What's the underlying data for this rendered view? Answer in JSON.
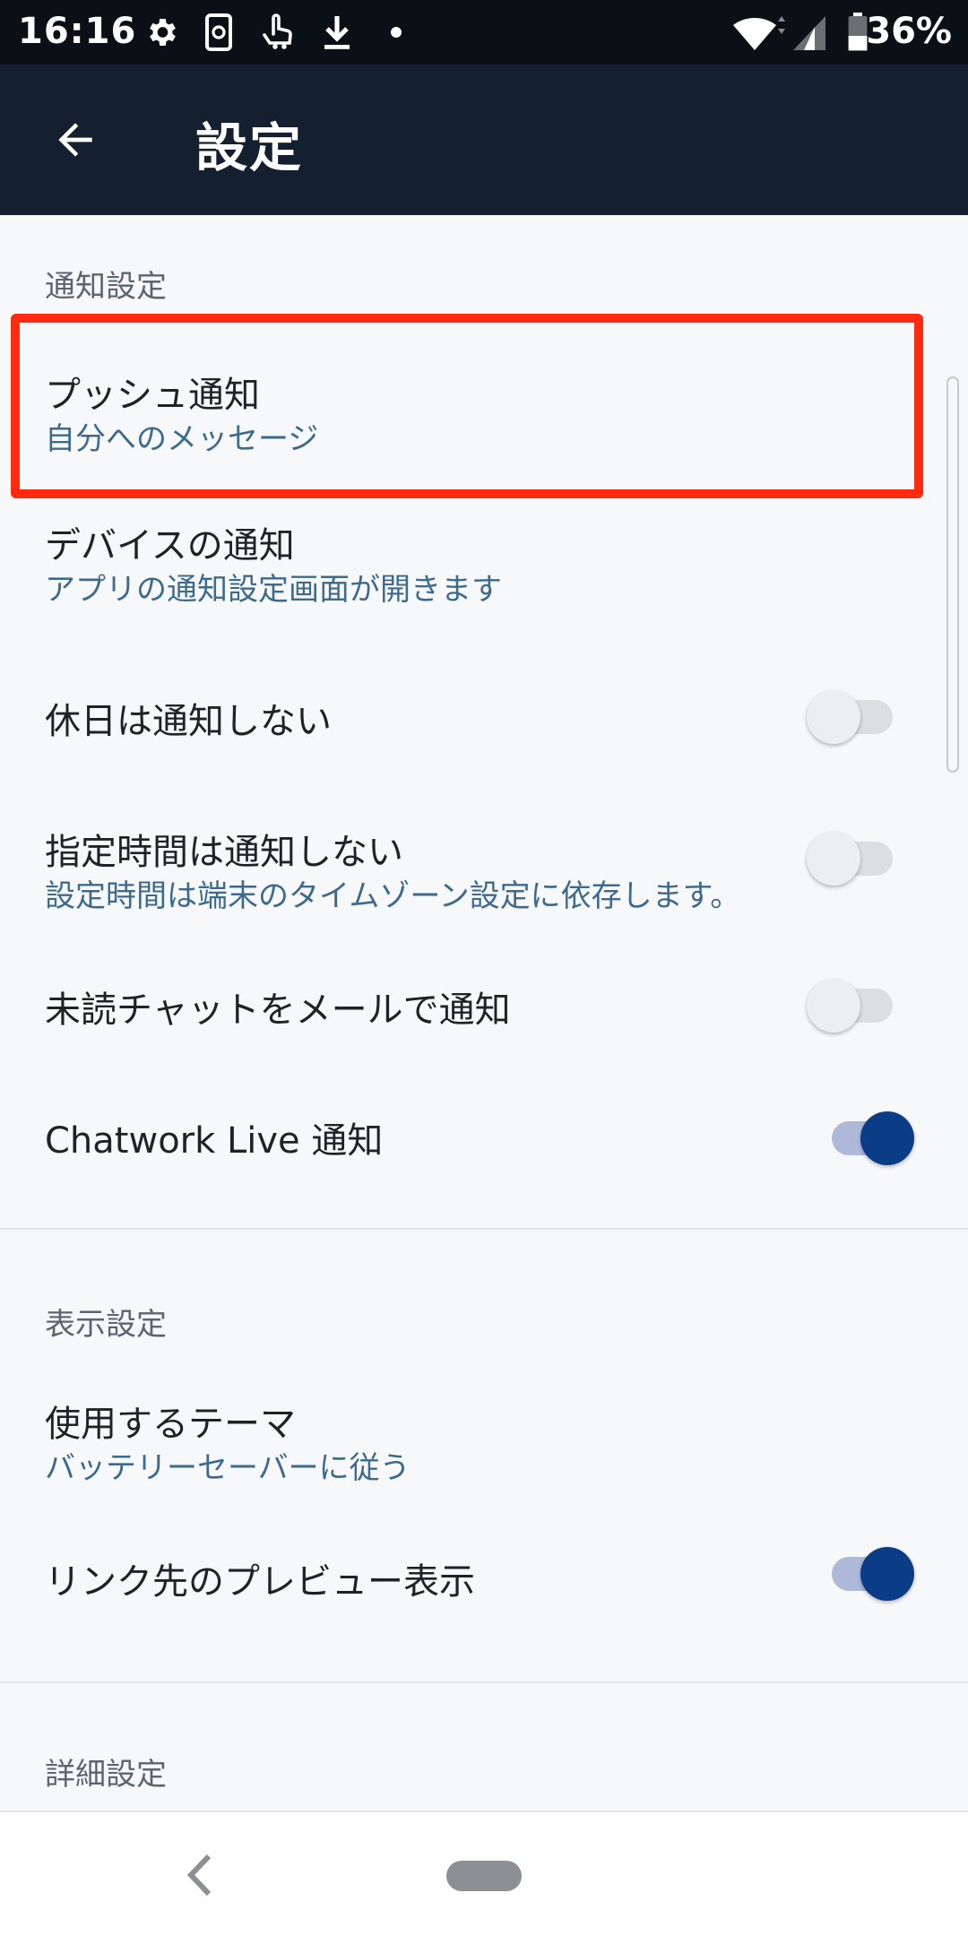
{
  "status_bar": {
    "time": "16:16",
    "battery_percent": "36%",
    "icons": [
      "gear-icon",
      "app-notification-icon",
      "touch-icon",
      "download-icon",
      "dot-icon",
      "wifi-icon",
      "signal-icon",
      "battery-icon"
    ]
  },
  "app_bar": {
    "title": "設定",
    "back_icon": "arrow-left-icon"
  },
  "sections": {
    "notification": {
      "header": "通知設定",
      "push": {
        "title": "プッシュ通知",
        "subtitle": "自分へのメッセージ"
      },
      "device": {
        "title": "デバイスの通知",
        "subtitle": "アプリの通知設定画面が開きます"
      },
      "holiday": {
        "title": "休日は通知しない",
        "enabled": false
      },
      "scheduled": {
        "title": "指定時間は通知しない",
        "subtitle": "設定時間は端末のタイムゾーン設定に依存します。",
        "enabled": false
      },
      "unread_mail": {
        "title": "未読チャットをメールで通知",
        "enabled": false
      },
      "live": {
        "title": "Chatwork Live 通知",
        "enabled": true
      }
    },
    "display": {
      "header": "表示設定",
      "theme": {
        "title": "使用するテーマ",
        "subtitle": "バッテリーセーバーに従う"
      },
      "link_preview": {
        "title": "リンク先のプレビュー表示",
        "enabled": true
      }
    },
    "advanced": {
      "header": "詳細設定"
    }
  },
  "nav_bar": {
    "back_icon": "chevron-left-icon",
    "home_icon": "home-pill-icon"
  },
  "colors": {
    "status_bar_bg": "#0b0f16",
    "app_bar_bg": "#14202f",
    "content_bg": "#f7f8fa",
    "subtitle_text": "#3e6a8e",
    "toggle_on": "#0b3d86",
    "highlight": "#ff2a10"
  }
}
